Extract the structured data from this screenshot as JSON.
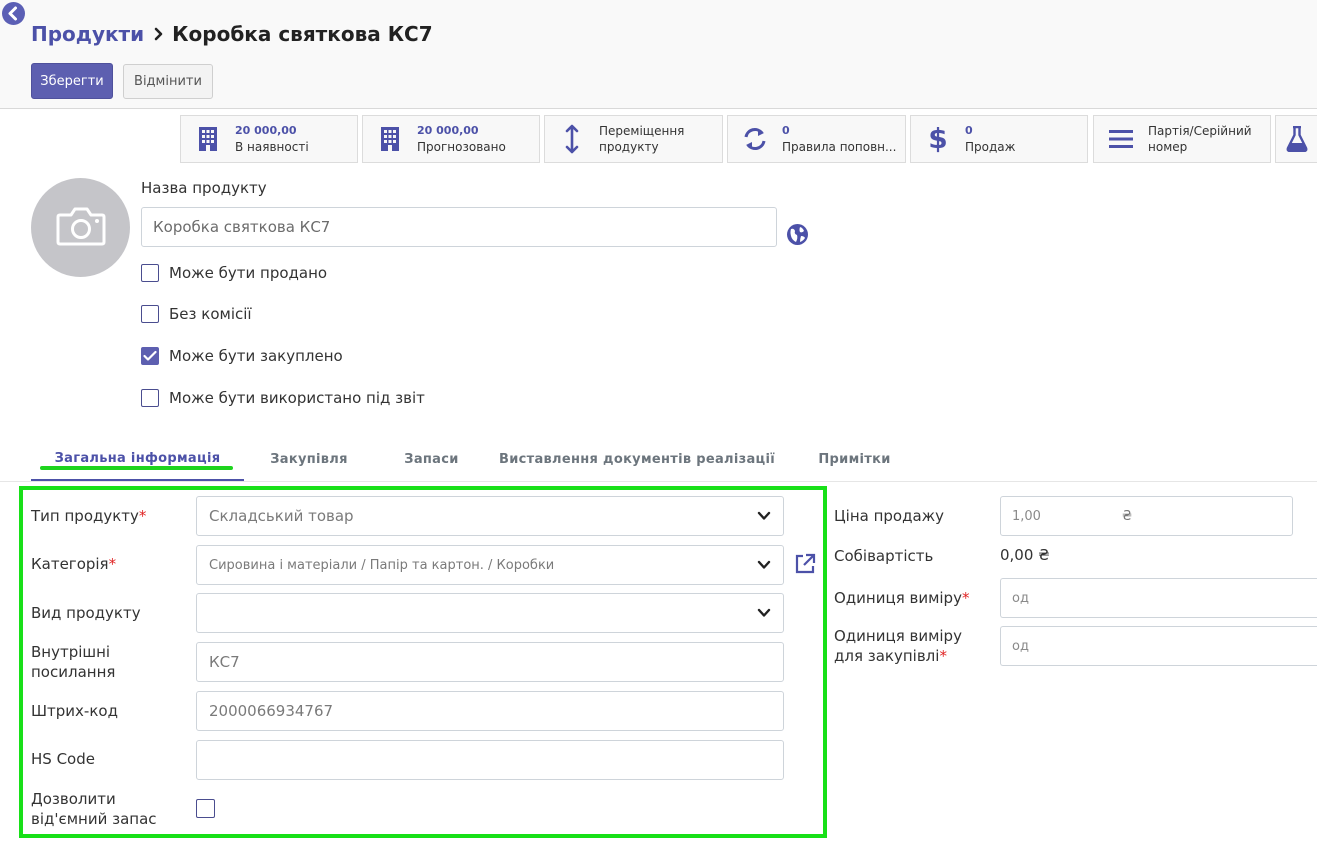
{
  "breadcrumb": {
    "parent": "Продукти",
    "current": "Коробка святкова КС7"
  },
  "actions": {
    "save": "Зберегти",
    "discard": "Відмінити"
  },
  "smart_buttons": [
    {
      "value": "20 000,00",
      "label": "В наявності",
      "icon": "building-icon"
    },
    {
      "value": "20 000,00",
      "label": "Прогнозовано",
      "icon": "building-icon"
    },
    {
      "line1": "Переміщення",
      "line2": "продукту",
      "icon": "up-down-arrows-icon"
    },
    {
      "value": "0",
      "label": "Правила поповн...",
      "icon": "refresh-icon"
    },
    {
      "value": "0",
      "label": "Продаж",
      "icon": "dollar-icon"
    },
    {
      "line1": "Партія/Серійний",
      "line2": "номер",
      "icon": "bars-icon"
    },
    {
      "icon": "flask-icon"
    }
  ],
  "product": {
    "name_label": "Назва продукту",
    "name_value": "Коробка святкова КС7"
  },
  "checkboxes": [
    {
      "label": "Може бути продано",
      "checked": false
    },
    {
      "label": "Без комісії",
      "checked": false
    },
    {
      "label": "Може бути закуплено",
      "checked": true
    },
    {
      "label": "Може бути використано під звіт",
      "checked": false
    }
  ],
  "tabs": [
    "Загальна інформація",
    "Закупівля",
    "Запаси",
    "Виставлення документів реалізації",
    "Примітки"
  ],
  "general": {
    "product_type": {
      "label": "Тип продукту",
      "value": "Складський товар"
    },
    "category": {
      "label": "Категорія",
      "value": "Сировина і матеріали / Папір та картон. / Коробки"
    },
    "product_kind": {
      "label": "Вид продукту",
      "value": ""
    },
    "internal_ref": {
      "label_line1": "Внутрішні",
      "label_line2": "посилання",
      "value": "КС7"
    },
    "barcode": {
      "label": "Штрих-код",
      "value": "2000066934767"
    },
    "hs_code": {
      "label": "HS Code",
      "value": ""
    },
    "allow_negative": {
      "label_line1": "Дозволити",
      "label_line2": "від'ємний запас",
      "checked": false
    }
  },
  "pricing": {
    "sale_price": {
      "label": "Ціна продажу",
      "value": "1,00",
      "currency": "₴"
    },
    "cost": {
      "label": "Собівартість",
      "value": "0,00 ₴"
    },
    "uom": {
      "label": "Одиниця виміру",
      "value": "од"
    },
    "purchase_uom": {
      "label_line1": "Одиниця виміру",
      "label_line2": "для закупівлі",
      "value": "од"
    }
  },
  "required_mark": "*",
  "colors": {
    "accent": "#5d5fb0",
    "link": "#4c51a8",
    "highlight": "#18e018",
    "required": "#e02424"
  }
}
